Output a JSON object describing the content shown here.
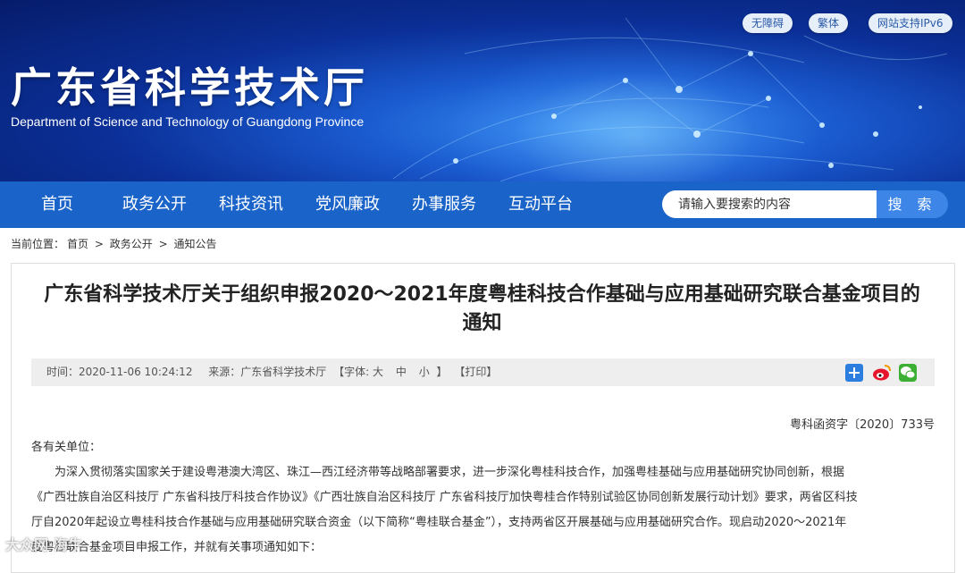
{
  "header": {
    "site_title": "广东省科学技术厅",
    "site_subtitle": "Department of Science and Technology of Guangdong Province",
    "top_links": [
      "无障碍",
      "繁体",
      "网站支持IPv6"
    ]
  },
  "nav": {
    "items": [
      "首页",
      "政务公开",
      "科技资讯",
      "党风廉政",
      "办事服务",
      "互动平台"
    ],
    "search_placeholder": "请输入要搜索的内容",
    "search_button": "搜 索"
  },
  "breadcrumb": {
    "prefix": "当前位置：",
    "items": [
      "首页",
      "政务公开",
      "通知公告"
    ],
    "separator": ">"
  },
  "article": {
    "title_line1": "广东省科学技术厅关于组织申报2020～2021年度粤桂科技合作基础与应用基础研究联合基金项目的",
    "title_line2": "通知",
    "time_label": "时间：2020-11-06 10:24:12",
    "source_label": "来源：广东省科学技术厅",
    "font_label": "【字体:",
    "font_big": "大",
    "font_mid": "中",
    "font_small": "小",
    "font_close": "】",
    "print_label": "【打印】",
    "share_icons": [
      "plus-share-icon",
      "weibo-icon",
      "wechat-icon"
    ],
    "doc_number": "粤科函资字〔2020〕733号",
    "salutation": "各有关单位：",
    "paragraph_lines": [
      "为深入贯彻落实国家关于建设粤港澳大湾区、珠江—西江经济带等战略部署要求，进一步深化粤桂科技合作，加强粤桂基础与应用基础研究协同创新，根据",
      "《广西壮族自治区科技厅 广东省科技厅科技合作协议》《广西壮族自治区科技厅 广东省科技厅加快粤桂合作特别试验区协同创新发展行动计划》要求，两省区科技",
      "厅自2020年起设立粤桂科技合作基础与应用基础研究联合资金（以下简称“粤桂联合基金”），支持两省区开展基础与应用基础研究合作。现启动2020～2021年",
      "度粤桂联合基金项目申报工作，并就有关事项通知如下："
    ]
  },
  "watermark": "大众网·海牛",
  "colors": {
    "nav_blue": "#1a63c9",
    "search_button": "#3d86e8",
    "banner_dark": "#061c6a"
  }
}
